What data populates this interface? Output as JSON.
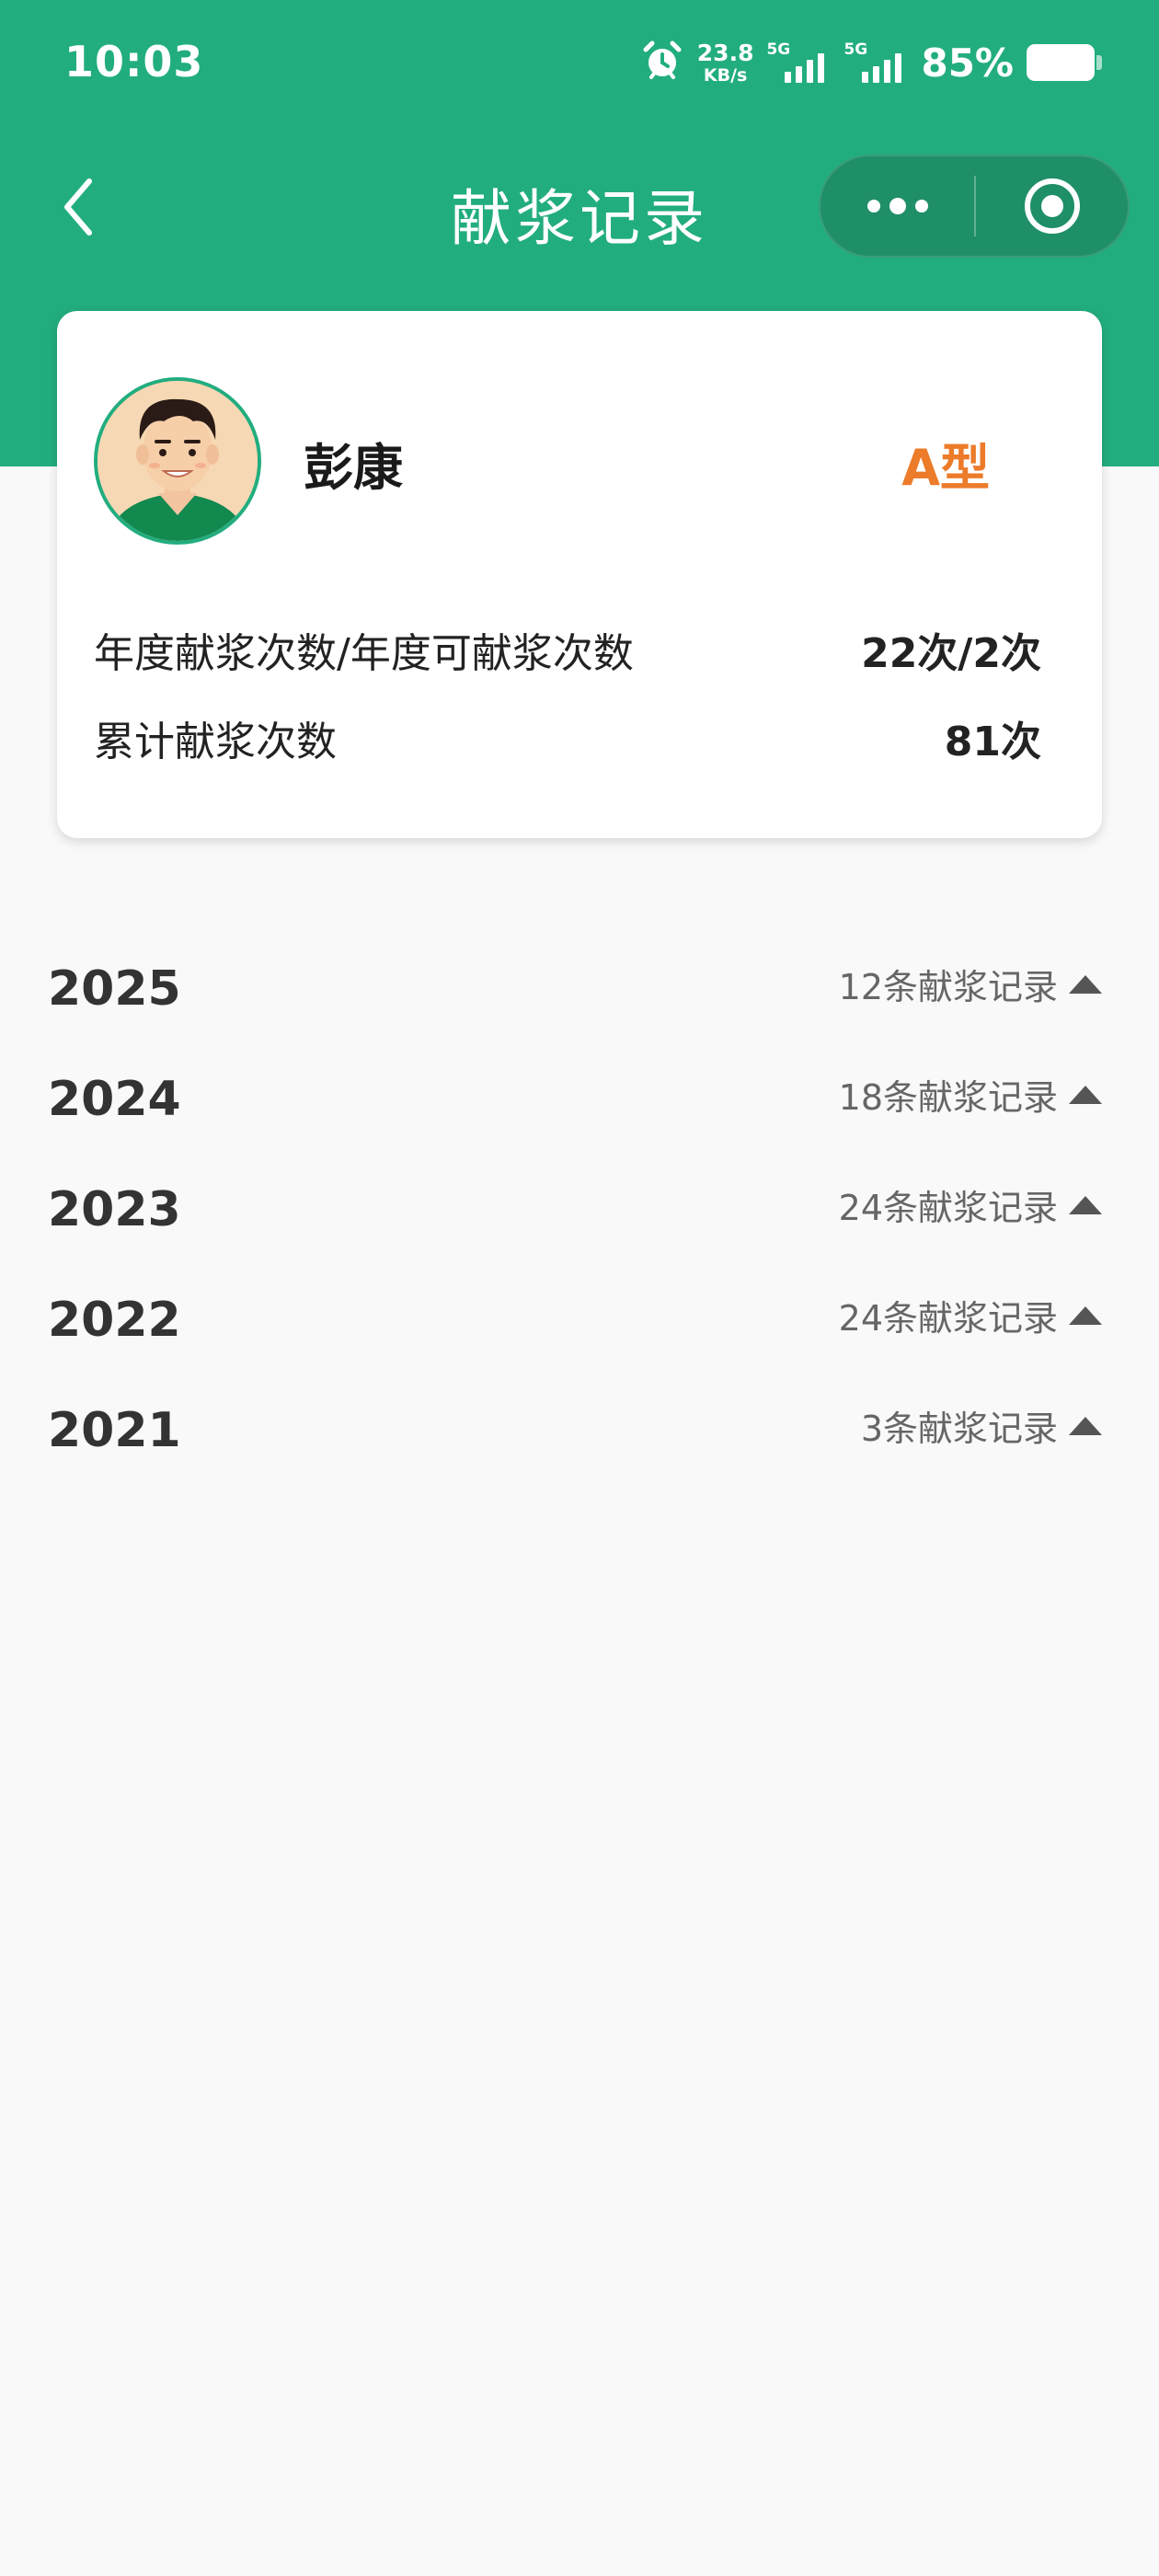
{
  "status_bar": {
    "time": "10:03",
    "net_speed_value": "23.8",
    "net_speed_unit": "KB/s",
    "sim1_label": "5G",
    "sim2_label": "5G",
    "battery_percent": "85%",
    "icons": [
      "alarm-icon",
      "signal-icon",
      "battery-icon"
    ]
  },
  "nav": {
    "title": "献浆记录",
    "icons": [
      "back-chevron-icon",
      "more-dots-icon",
      "close-target-icon"
    ]
  },
  "profile": {
    "name": "彭康",
    "blood_type": "A型",
    "annual_label": "年度献浆次数/年度可献浆次数",
    "annual_value": "22次/2次",
    "total_label": "累计献浆次数",
    "total_value": "81次"
  },
  "years": [
    {
      "year": "2025",
      "count_text": "12条献浆记录"
    },
    {
      "year": "2024",
      "count_text": "18条献浆记录"
    },
    {
      "year": "2023",
      "count_text": "24条献浆记录"
    },
    {
      "year": "2022",
      "count_text": "24条献浆记录"
    },
    {
      "year": "2021",
      "count_text": "3条献浆记录"
    }
  ],
  "colors": {
    "brand_green": "#22ad7f",
    "capsule_green": "#1f8f67",
    "blood_type_orange": "#ec7b2a",
    "page_bg": "#f9f9f9"
  }
}
